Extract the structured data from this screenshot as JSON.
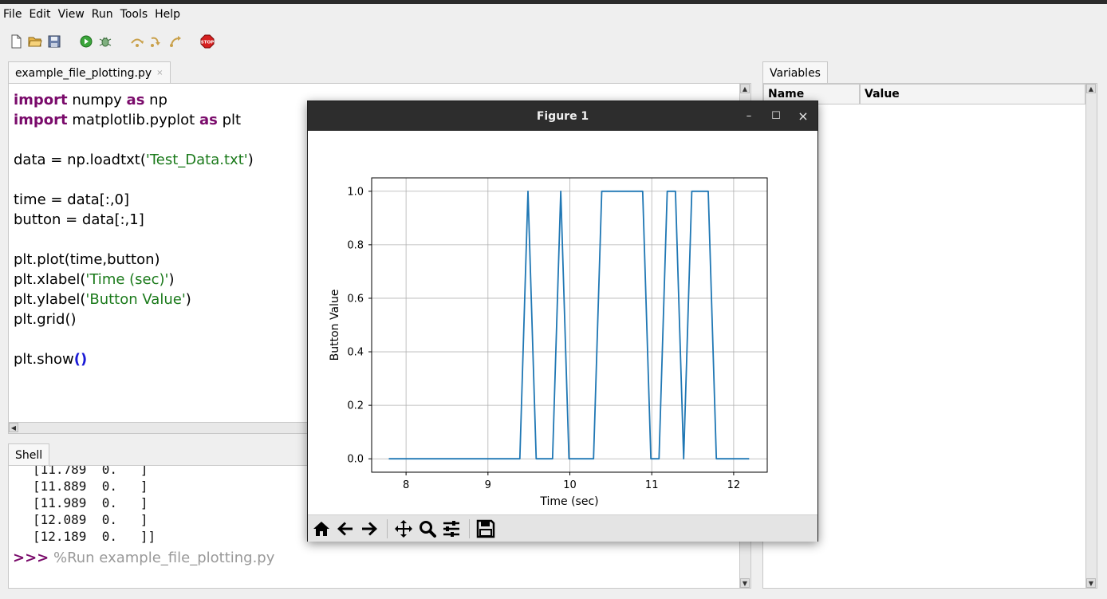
{
  "menu": [
    "File",
    "Edit",
    "View",
    "Run",
    "Tools",
    "Help"
  ],
  "toolbar": {
    "icons": [
      "new-file-icon",
      "open-folder-icon",
      "save-icon",
      "run-icon",
      "debug-icon",
      "step-over-icon",
      "step-into-icon",
      "step-out-icon",
      "stop-icon"
    ]
  },
  "editor": {
    "tab_title": "example_file_plotting.py",
    "tab_close": "×",
    "code_lines": [
      [
        {
          "t": "import",
          "c": "kw"
        },
        {
          "t": " numpy "
        },
        {
          "t": "as",
          "c": "kw"
        },
        {
          "t": " np"
        }
      ],
      [
        {
          "t": "import",
          "c": "kw"
        },
        {
          "t": " matplotlib.pyplot "
        },
        {
          "t": "as",
          "c": "kw"
        },
        {
          "t": " plt"
        }
      ],
      [],
      [
        {
          "t": "data = np.loadtxt("
        },
        {
          "t": "'Test_Data.txt'",
          "c": "str"
        },
        {
          "t": ")"
        }
      ],
      [],
      [
        {
          "t": "time = data[:,0]"
        }
      ],
      [
        {
          "t": "button = data[:,1]"
        }
      ],
      [],
      [
        {
          "t": "plt.plot(time,button)"
        }
      ],
      [
        {
          "t": "plt.xlabel("
        },
        {
          "t": "'Time (sec)'",
          "c": "str"
        },
        {
          "t": ")"
        }
      ],
      [
        {
          "t": "plt.ylabel("
        },
        {
          "t": "'Button Value'",
          "c": "str"
        },
        {
          "t": ")"
        }
      ],
      [
        {
          "t": "plt.grid()"
        }
      ],
      [],
      [
        {
          "t": "plt.show"
        },
        {
          "t": "()",
          "c": "par"
        }
      ]
    ]
  },
  "shell": {
    "tab_title": "Shell",
    "output_lines": [
      "[11.789  0.   ]",
      "[11.889  0.   ]",
      "[11.989  0.   ]",
      "[12.089  0.   ]",
      "[12.189  0.   ]]"
    ],
    "prompt": ">>>",
    "command": " %Run example_file_plotting.py"
  },
  "variables": {
    "tab_title": "Variables",
    "col_name": "Name",
    "col_value": "Value"
  },
  "figure": {
    "title": "Figure 1",
    "controls": {
      "minimize": "–",
      "maximize": "☐",
      "close": "×"
    },
    "tools": [
      "home-icon",
      "back-icon",
      "forward-icon",
      "pan-icon",
      "zoom-icon",
      "configure-subplots-icon",
      "save-figure-icon"
    ]
  },
  "chart_data": {
    "type": "line",
    "title": "",
    "xlabel": "Time (sec)",
    "ylabel": "Button Value",
    "xlim": [
      7.58,
      12.41
    ],
    "ylim": [
      -0.05,
      1.05
    ],
    "xticks": [
      8,
      9,
      10,
      11,
      12
    ],
    "yticks": [
      0.0,
      0.2,
      0.4,
      0.6,
      0.8,
      1.0
    ],
    "ytick_labels": [
      "0.0",
      "0.2",
      "0.4",
      "0.6",
      "0.8",
      "1.0"
    ],
    "grid": true,
    "color": "#1f77b4",
    "series": [
      {
        "x": [
          7.789,
          9.389,
          9.489,
          9.589,
          9.789,
          9.889,
          9.989,
          10.289,
          10.389,
          10.889,
          10.989,
          11.089,
          11.189,
          11.289,
          11.389,
          11.489,
          11.689,
          11.789,
          12.189
        ],
        "y": [
          0,
          0,
          1,
          0,
          0,
          1,
          0,
          0,
          1,
          1,
          0,
          0,
          1,
          1,
          0,
          1,
          1,
          0,
          0
        ]
      }
    ]
  }
}
